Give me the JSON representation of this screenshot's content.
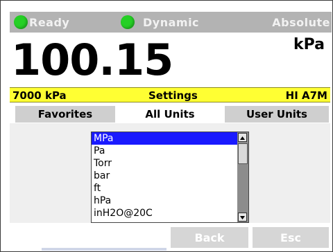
{
  "status": {
    "items": [
      {
        "label": "Ready",
        "color": "#25d025"
      },
      {
        "label": "Dynamic",
        "color": "#25d025"
      },
      {
        "label": "Absolute"
      }
    ]
  },
  "reading": {
    "value": "100.15",
    "unit": "kPa"
  },
  "info_bar": {
    "range": "7000 kPa",
    "title": "Settings",
    "sensor": "HI A7M",
    "color": "#ffff33"
  },
  "tabs": [
    {
      "label": "Favorites",
      "active": false
    },
    {
      "label": "All Units",
      "active": true
    },
    {
      "label": "User Units",
      "active": false
    }
  ],
  "unit_list": {
    "items": [
      "MPa",
      "Pa",
      "Torr",
      "bar",
      "ft",
      "hPa",
      "inH2O@20C"
    ],
    "selected": "MPa"
  },
  "buttons": {
    "back": "Back",
    "esc": "Esc"
  }
}
